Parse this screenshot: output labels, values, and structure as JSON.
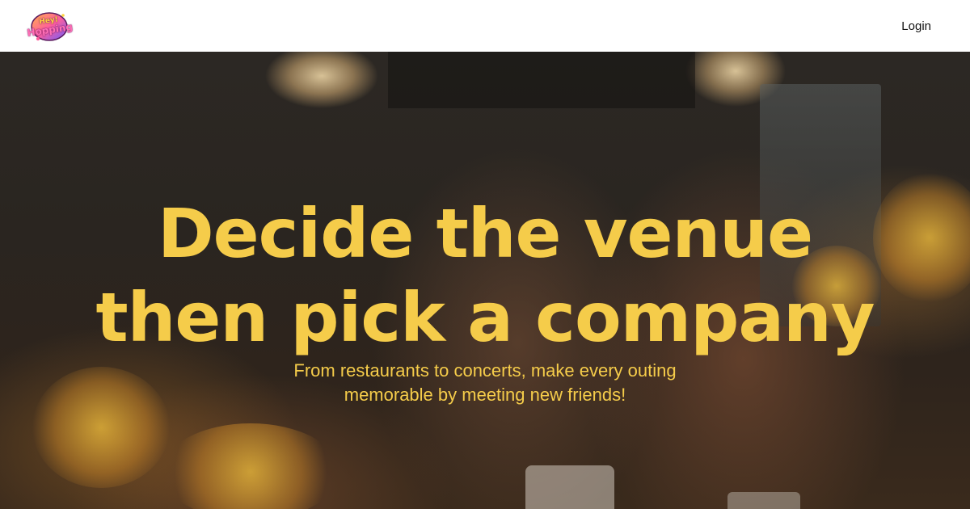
{
  "header": {
    "logo": {
      "alt": "Hey! Hopping",
      "line1": "Hey!",
      "line2": "Hopping"
    },
    "login_label": "Login"
  },
  "hero": {
    "headline_line1": "Decide the venue",
    "headline_line2": "then pick a company",
    "subtitle_line1": "From restaurants to concerts, make every outing",
    "subtitle_line2": "memorable by meeting new friends!",
    "background_image": "two-women-laughing-at-cafe"
  },
  "colors": {
    "accent": "#f5cc4a",
    "header_bg": "#ffffff",
    "login_text": "#111111"
  }
}
